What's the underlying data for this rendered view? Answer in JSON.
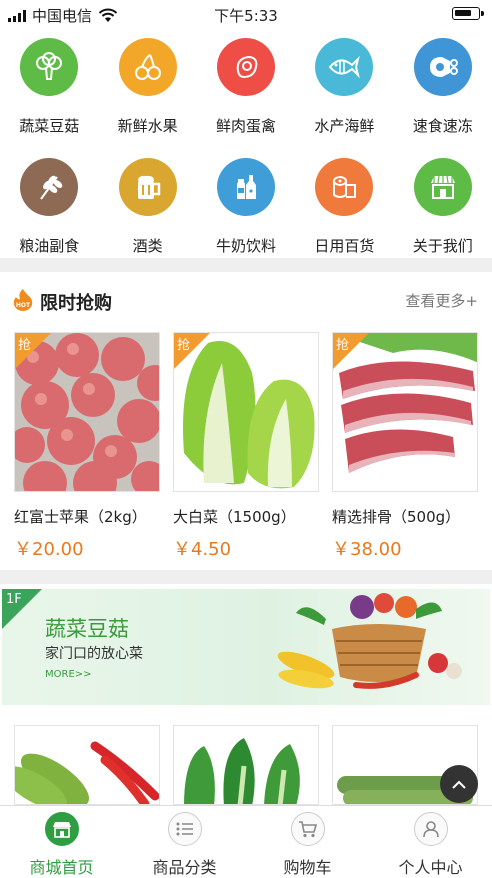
{
  "status_bar": {
    "carrier": "中国电信",
    "time": "下午5:33"
  },
  "categories": [
    {
      "label": "蔬菜豆菇",
      "icon": "broccoli-icon",
      "color": "#5dbb46"
    },
    {
      "label": "新鲜水果",
      "icon": "cherry-icon",
      "color": "#f3a728"
    },
    {
      "label": "鲜肉蛋禽",
      "icon": "meat-icon",
      "color": "#ee4e46"
    },
    {
      "label": "水产海鲜",
      "icon": "fish-icon",
      "color": "#4ab9d8"
    },
    {
      "label": "速食速冻",
      "icon": "ham-icon",
      "color": "#3f95d6"
    },
    {
      "label": "粮油副食",
      "icon": "wheat-icon",
      "color": "#8e6a55"
    },
    {
      "label": "酒类",
      "icon": "beer-icon",
      "color": "#d9a730"
    },
    {
      "label": "牛奶饮料",
      "icon": "bottles-icon",
      "color": "#3f9ed8"
    },
    {
      "label": "日用百货",
      "icon": "tissue-icon",
      "color": "#f07a3c"
    },
    {
      "label": "关于我们",
      "icon": "store-icon",
      "color": "#5dbb46"
    }
  ],
  "flash_sale": {
    "hot_badge": "HOT",
    "title": "限时抢购",
    "more": "查看更多+",
    "tag": "抢",
    "products": [
      {
        "name": "红富士苹果（2kg）",
        "price": "￥20.00"
      },
      {
        "name": "大白菜（1500g）",
        "price": "￥4.50"
      },
      {
        "name": "精选排骨（500g）",
        "price": "￥38.00"
      }
    ]
  },
  "floor": {
    "index": "1F",
    "title": "蔬菜豆菇",
    "subtitle": "家门口的放心菜",
    "more": "MORE>>"
  },
  "tabbar": [
    {
      "label": "商城首页",
      "icon": "store-icon",
      "active": true
    },
    {
      "label": "商品分类",
      "icon": "list-icon",
      "active": false
    },
    {
      "label": "购物车",
      "icon": "cart-icon",
      "active": false
    },
    {
      "label": "个人中心",
      "icon": "user-icon",
      "active": false
    }
  ]
}
